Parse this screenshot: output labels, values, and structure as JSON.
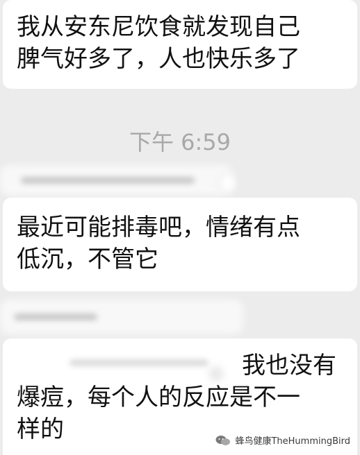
{
  "messages": [
    {
      "lines": [
        "我从安东尼饮食就发现自己",
        "脾气好多了，人也快乐多了"
      ]
    },
    {
      "lines": [
        "最近可能排毒吧，情绪有点",
        "低沉，不管它"
      ]
    },
    {
      "lines": [
        "我也没有",
        "爆痘，每个人的反应是不一",
        "样的"
      ]
    }
  ],
  "timestamp": "下午 6:59",
  "watermark": {
    "icon": "wechat-icon",
    "text": "蜂鸟健康TheHummingBird"
  }
}
